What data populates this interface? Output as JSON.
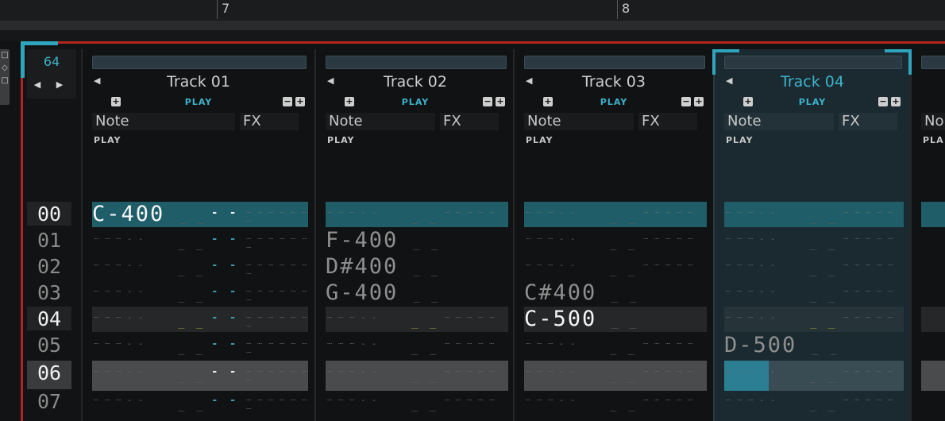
{
  "timeline": {
    "markers": [
      "7",
      "8"
    ]
  },
  "pattern": {
    "length": "64",
    "nav_arrows": "◀ ▶"
  },
  "left_controls": [
    "□",
    "◇",
    "□"
  ],
  "row_numbers": [
    "00",
    "01",
    "02",
    "03",
    "04",
    "05",
    "06",
    "07"
  ],
  "tracks": [
    {
      "name": "Track 01",
      "mode": "PLAY",
      "note_label": "Note",
      "fx_label": "FX",
      "sub_mode": "PLAY",
      "notes": [
        "C-400",
        "",
        "",
        "",
        "",
        "",
        "",
        ""
      ]
    },
    {
      "name": "Track 02",
      "mode": "PLAY",
      "note_label": "Note",
      "fx_label": "FX",
      "sub_mode": "PLAY",
      "notes": [
        "",
        "F-400",
        "D#400",
        "G-400",
        "",
        "",
        "",
        ""
      ]
    },
    {
      "name": "Track 03",
      "mode": "PLAY",
      "note_label": "Note",
      "fx_label": "FX",
      "sub_mode": "PLAY",
      "notes": [
        "",
        "",
        "",
        "C#400",
        "C-500",
        "",
        "",
        ""
      ]
    },
    {
      "name": "Track 04",
      "mode": "PLAY",
      "note_label": "Note",
      "fx_label": "FX",
      "sub_mode": "PLAY",
      "notes": [
        "",
        "",
        "",
        "",
        "",
        "D-500",
        "",
        ""
      ]
    },
    {
      "name": "",
      "mode": "",
      "note_label": "No",
      "fx_label": "",
      "sub_mode": "PLA",
      "notes": [
        "",
        "",
        "",
        "",
        "",
        "",
        "",
        ""
      ]
    }
  ],
  "glyphs": {
    "plus": "+",
    "minus": "−",
    "prev": "◀"
  },
  "colors": {
    "accent": "#3cb3cc",
    "playhead": "#1f5e69",
    "loop_marker": "#b3261e"
  }
}
